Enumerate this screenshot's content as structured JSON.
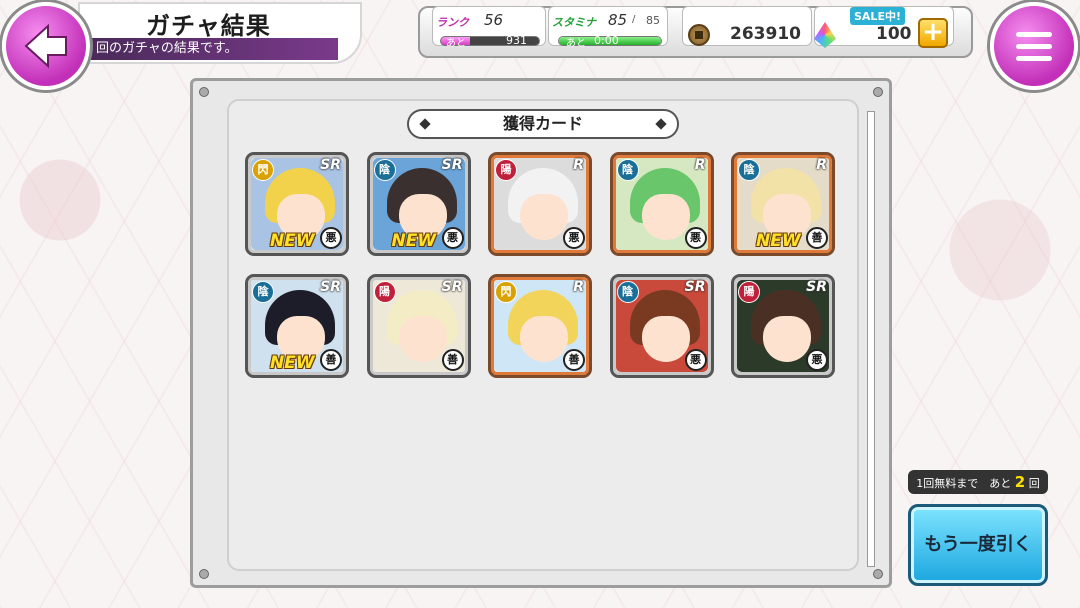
{
  "header": {
    "title": "ガチャ結果",
    "subtitle": "回のガチャの結果です。"
  },
  "status": {
    "rank_label": "ランク",
    "rank_value": "56",
    "rank_next_label": "あと",
    "rank_next_value": "931",
    "stamina_label": "スタミナ",
    "stamina_value": "85",
    "stamina_max": "85",
    "stamina_next_label": "あと",
    "stamina_timer": "0:00",
    "coins": "263910",
    "sale_badge": "SALE中!",
    "gems": "100",
    "plus_label": "+"
  },
  "panel": {
    "section_title": "獲得カード"
  },
  "cards": [
    {
      "rarity": "SR",
      "type": "閃",
      "type_color": "#d9a200",
      "align": "悪",
      "new": "NEW",
      "frame": "sr",
      "hair": "#f2d24a",
      "bg": "#a8c3e3"
    },
    {
      "rarity": "SR",
      "type": "陰",
      "type_color": "#1a6f98",
      "align": "悪",
      "new": "NEW",
      "frame": "sr",
      "hair": "#3a3030",
      "bg": "#6aa4d9"
    },
    {
      "rarity": "R",
      "type": "陽",
      "type_color": "#c0203a",
      "align": "悪",
      "new": "",
      "frame": "r",
      "hair": "#f2f2f2",
      "bg": "#dcdcdc"
    },
    {
      "rarity": "R",
      "type": "陰",
      "type_color": "#1a6f98",
      "align": "悪",
      "new": "",
      "frame": "r",
      "hair": "#6ac66a",
      "bg": "#d6e8c2"
    },
    {
      "rarity": "R",
      "type": "陰",
      "type_color": "#1a6f98",
      "align": "善",
      "new": "NEW",
      "frame": "r",
      "hair": "#f2e2a8",
      "bg": "#e4dcc8"
    },
    {
      "rarity": "SR",
      "type": "陰",
      "type_color": "#1a6f98",
      "align": "善",
      "new": "NEW",
      "frame": "sr",
      "hair": "#1d1d2a",
      "bg": "#cfe0ee"
    },
    {
      "rarity": "SR",
      "type": "陽",
      "type_color": "#c0203a",
      "align": "善",
      "new": "",
      "frame": "sr",
      "hair": "#f4ecc4",
      "bg": "#eee8d8"
    },
    {
      "rarity": "R",
      "type": "閃",
      "type_color": "#d9a200",
      "align": "善",
      "new": "",
      "frame": "r",
      "hair": "#f3d45a",
      "bg": "#cfe6f6"
    },
    {
      "rarity": "SR",
      "type": "陰",
      "type_color": "#1a6f98",
      "align": "悪",
      "new": "",
      "frame": "sr",
      "hair": "#7a3a22",
      "bg": "#c94a3a"
    },
    {
      "rarity": "SR",
      "type": "陽",
      "type_color": "#c0203a",
      "align": "悪",
      "new": "",
      "frame": "sr",
      "hair": "#4a3024",
      "bg": "#2c3a2a"
    }
  ],
  "free_notice": {
    "prefix": "1回無料まで　あと",
    "count": "2",
    "suffix": "回"
  },
  "redraw_button": "もう一度引く"
}
